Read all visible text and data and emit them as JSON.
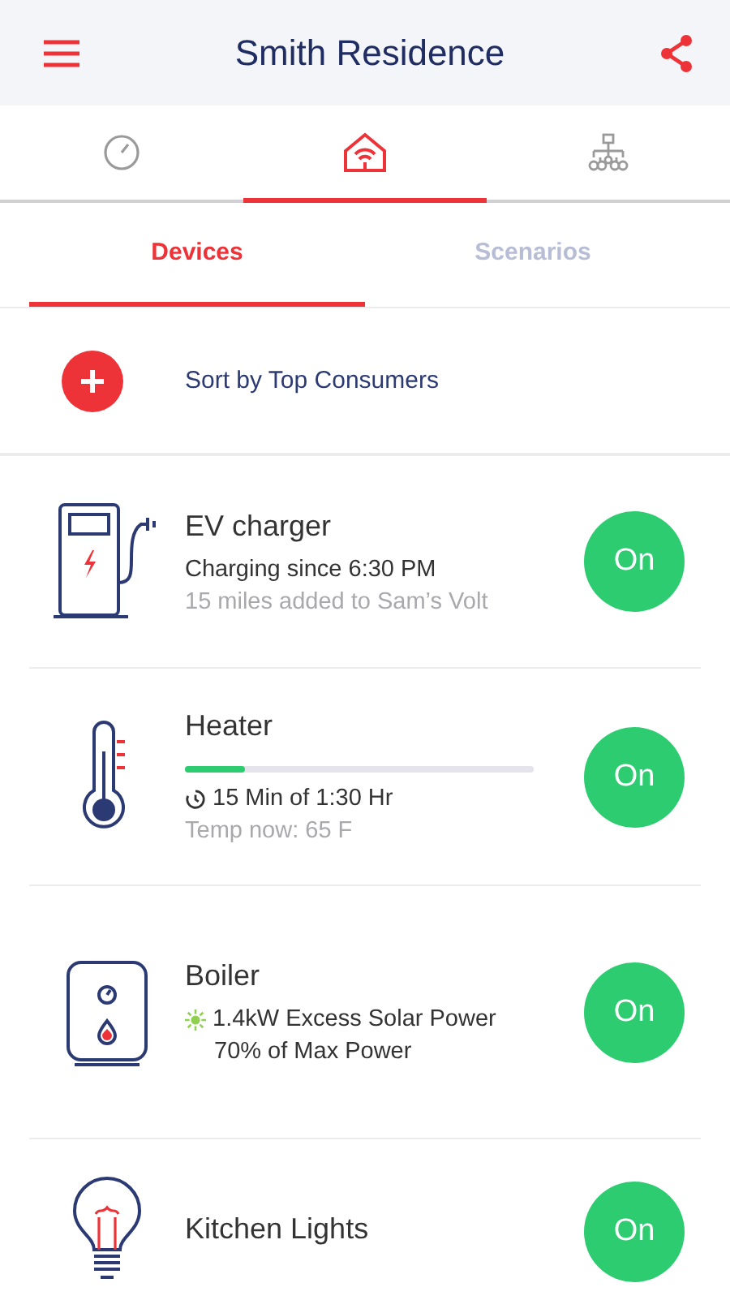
{
  "header": {
    "title": "Smith Residence"
  },
  "nav_tabs": [
    {
      "kind": "gauge",
      "selected": false
    },
    {
      "kind": "home",
      "selected": true
    },
    {
      "kind": "network",
      "selected": false
    }
  ],
  "sub_tabs": [
    {
      "label": "Devices",
      "selected": true
    },
    {
      "label": "Scenarios",
      "selected": false
    }
  ],
  "sort": {
    "label": "Sort by Top Consumers"
  },
  "devices": [
    {
      "kind": "ev",
      "name": "EV charger",
      "toggle": {
        "label": "On",
        "on": true
      },
      "lines": [
        {
          "kind": "primary",
          "text": "Charging since 6:30 PM"
        },
        {
          "kind": "secondary",
          "text": "15 miles added to Sam’s Volt"
        }
      ]
    },
    {
      "kind": "heater",
      "name": "Heater",
      "level": 0.17,
      "toggle": {
        "label": "On",
        "on": true
      },
      "lines": [
        {
          "kind": "timer",
          "text": "15 Min of 1:30 Hr"
        },
        {
          "kind": "secondary",
          "text": "Temp now: 65 F"
        }
      ]
    },
    {
      "kind": "boiler",
      "name": "Boiler",
      "toggle": {
        "label": "On",
        "on": true
      },
      "lines": [
        {
          "kind": "solar",
          "text": "1.4kW Excess Solar Power"
        },
        {
          "kind": "indented",
          "text": "70% of Max Power"
        }
      ]
    },
    {
      "kind": "light",
      "name": "Kitchen Lights",
      "toggle": {
        "label": "On",
        "on": true
      }
    }
  ]
}
